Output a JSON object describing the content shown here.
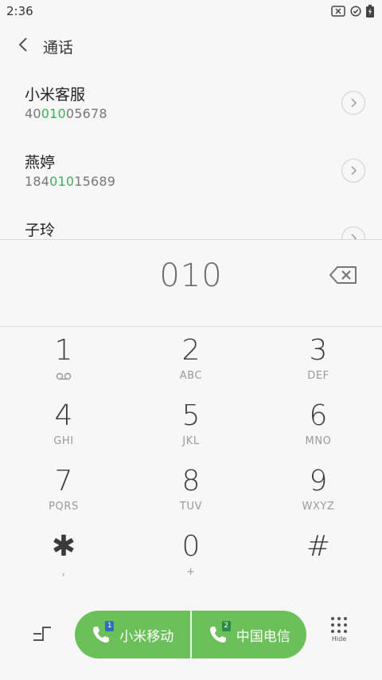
{
  "status": {
    "time": "2:36",
    "icons": [
      "sim-off-icon",
      "check-circle-icon",
      "battery-charging-icon"
    ]
  },
  "header": {
    "title": "通话",
    "back_icon": "chevron-left-icon"
  },
  "contacts": [
    {
      "name": "小米客服",
      "number_pre": "40",
      "number_match": "010",
      "number_post": "05678"
    },
    {
      "name": "燕婷",
      "number_pre": "184",
      "number_match": "010",
      "number_post": "15689"
    },
    {
      "name": "子玲",
      "number_pre": "",
      "number_match": "",
      "number_post": ""
    }
  ],
  "dialer": {
    "number": "010",
    "backspace_icon": "backspace-icon"
  },
  "keypad": [
    {
      "digit": "1",
      "letters": "",
      "sub_icon": "voicemail-icon"
    },
    {
      "digit": "2",
      "letters": "ABC"
    },
    {
      "digit": "3",
      "letters": "DEF"
    },
    {
      "digit": "4",
      "letters": "GHI"
    },
    {
      "digit": "5",
      "letters": "JKL"
    },
    {
      "digit": "6",
      "letters": "MNO"
    },
    {
      "digit": "7",
      "letters": "PQRS"
    },
    {
      "digit": "8",
      "letters": "TUV"
    },
    {
      "digit": "9",
      "letters": "WXYZ"
    },
    {
      "digit": "✱",
      "letters": ","
    },
    {
      "digit": "0",
      "letters": "+"
    },
    {
      "digit": "#",
      "letters": ""
    }
  ],
  "bottom": {
    "sim1": {
      "label": "小米移动",
      "badge": "1",
      "badge_color": "#2f6fb3"
    },
    "sim2": {
      "label": "中国电信",
      "badge": "2",
      "badge_color": "#2a8a4a"
    },
    "hide_label": "Hide",
    "accent": "#6cc05a"
  }
}
